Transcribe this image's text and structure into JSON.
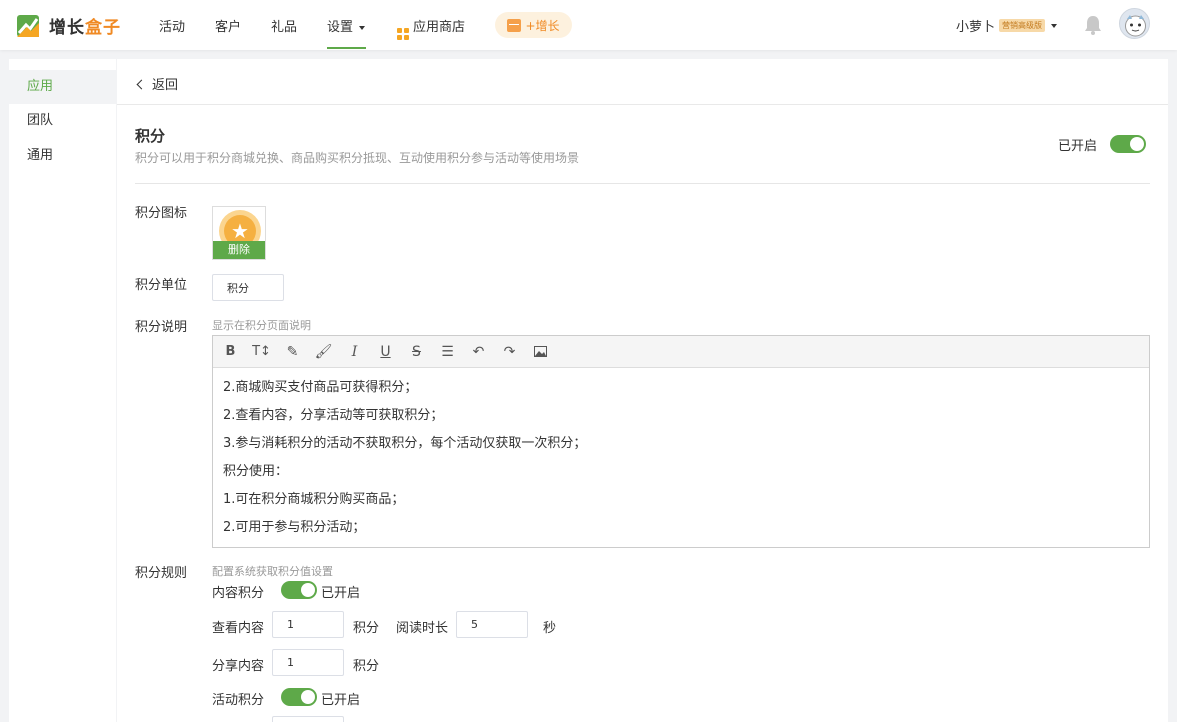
{
  "header": {
    "logo_text_main": "增长",
    "logo_text_accent": "盒子",
    "nav": [
      {
        "label": "活动"
      },
      {
        "label": "客户"
      },
      {
        "label": "礼品"
      },
      {
        "label": "设置"
      }
    ],
    "store_label": "应用商店",
    "grow_label": "+增长",
    "user_name": "小萝卜",
    "user_badge": "营销高级版"
  },
  "sidebar": {
    "items": [
      {
        "label": "应用",
        "active": true
      },
      {
        "label": "团队",
        "active": false
      },
      {
        "label": "通用",
        "active": false
      }
    ]
  },
  "main": {
    "back_label": "返回",
    "title": "积分",
    "subtitle": "积分可以用于积分商城兑换、商品购买积分抵现、互动使用积分参与活动等使用场景",
    "enabled_label": "已开启",
    "icon_label": "积分图标",
    "delete_label": "删除",
    "unit_label": "积分单位",
    "unit_value": "积分",
    "desc_label": "积分说明",
    "desc_hint": "显示在积分页面说明",
    "desc_lines": [
      "2.商城购买支付商品可获得积分；",
      "2.查看内容，分享活动等可获取积分；",
      "3.参与消耗积分的活动不获取积分，每个活动仅获取一次积分；",
      "积分使用：",
      "1.可在积分商城积分购买商品；",
      "2.可用于参与积分活动；"
    ],
    "rules_label": "积分规则",
    "rules_hint": "配置系统获取积分值设置",
    "content_points_label": "内容积分",
    "content_points_status": "已开启",
    "view_content_label": "查看内容",
    "view_content_value": "1",
    "points_unit": "积分",
    "read_duration_label": "阅读时长",
    "read_duration_value": "5",
    "seconds_unit": "秒",
    "share_content_label": "分享内容",
    "share_content_value": "1",
    "activity_points_label": "活动积分",
    "activity_points_status": "已开启"
  },
  "colors": {
    "accent_green": "#5ea949",
    "accent_orange": "#f08a24"
  }
}
